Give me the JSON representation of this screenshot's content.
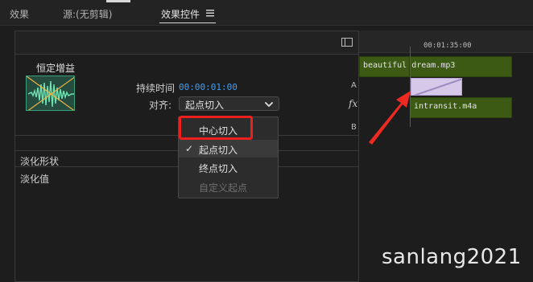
{
  "top_bar": {
    "tabs": [
      {
        "label": "效果"
      },
      {
        "label": "源:(无剪辑)"
      },
      {
        "label": "效果控件"
      }
    ],
    "menu_icon": "hamburger-icon"
  },
  "panel": {
    "toggle_icon": "panel-toggle-icon",
    "effect_name": "恒定增益",
    "duration_label": "持续时间",
    "duration_value": "00:00:01:00",
    "align_label": "对齐:",
    "align_selected": "起点切入",
    "side_labels": {
      "a": "A",
      "fx": "fx",
      "b": "B"
    },
    "fade_shape_label": "淡化形状",
    "fade_value_label": "淡化值"
  },
  "timeline": {
    "time": "00:01:35:00",
    "clips": [
      {
        "label": "beautiful dream.mp3"
      },
      {
        "label": "intransit.m4a"
      }
    ]
  },
  "dropdown": {
    "items": [
      {
        "label": "中心切入",
        "checked": false,
        "disabled": false
      },
      {
        "label": "起点切入",
        "checked": true,
        "disabled": false
      },
      {
        "label": "终点切入",
        "checked": false,
        "disabled": false
      },
      {
        "label": "自定义起点",
        "checked": false,
        "disabled": true
      }
    ]
  },
  "watermark": "sanlang2021",
  "colors": {
    "accent_blue": "#3f9ff5",
    "clip_green": "#3c5a14",
    "highlight_red": "#ec1e1e",
    "transition_lavender": "#d6c8e8"
  }
}
